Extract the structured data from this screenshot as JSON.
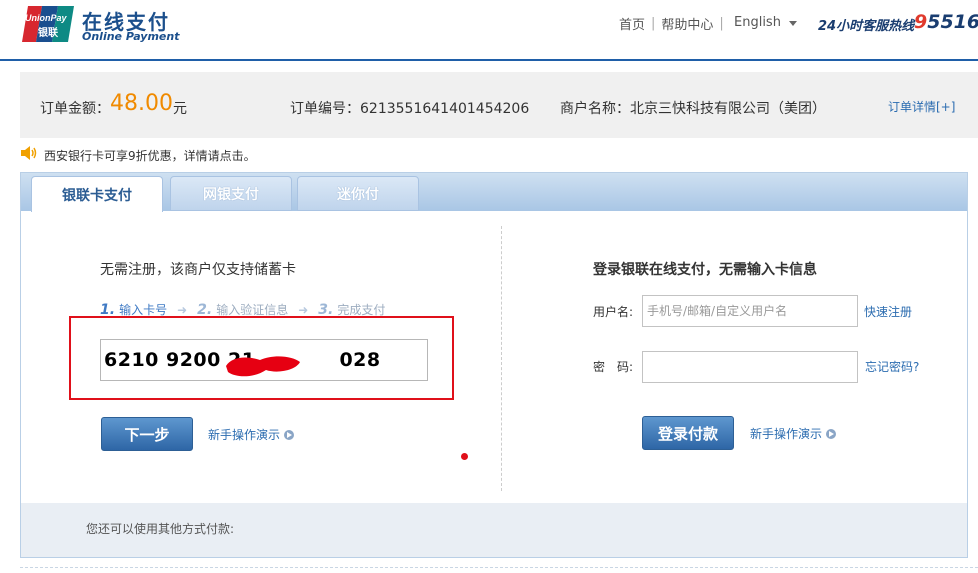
{
  "header": {
    "logo_brand": "在线支付",
    "logo_sub": "Online Payment",
    "logo_text_top": "UnionPay",
    "logo_text_bottom": "银联",
    "nav": [
      {
        "label": "首页"
      },
      {
        "label": "帮助中心"
      }
    ],
    "language": "English",
    "hotline_label": "24小时客服热线",
    "hotline_number_a": "9",
    "hotline_number_b": "5516"
  },
  "order": {
    "amount_label": "订单金额：",
    "amount": "48.00",
    "currency": "元",
    "number_label": "订单编号：",
    "number": "6213551641401454206",
    "merchant_label": "商户名称：",
    "merchant": "北京三快科技有限公司（美团）",
    "details_link": "订单详情[+]"
  },
  "notice": "西安银行卡可享9折优惠，详情请点击。",
  "tabs": [
    {
      "label": "银联卡支付",
      "active": true
    },
    {
      "label": "网银支付",
      "active": false
    },
    {
      "label": "迷你付",
      "active": false
    }
  ],
  "card_pay": {
    "title": "无需注册，该商户仅支持储蓄卡",
    "steps": [
      {
        "num": "1.",
        "label": "输入卡号",
        "active": true
      },
      {
        "num": "2.",
        "label": "输入验证信息",
        "active": false
      },
      {
        "num": "3.",
        "label": "完成支付",
        "active": false
      }
    ],
    "card_number_start": "6210 9200 21",
    "card_number_end": "028",
    "next_button": "下一步",
    "demo_link": "新手操作演示"
  },
  "login": {
    "title": "登录银联在线支付，无需输入卡信息",
    "username_label": "用户名:",
    "username_placeholder": "手机号/邮箱/自定义用户名",
    "register_link": "快速注册",
    "password_label": "密　码:",
    "forgot_link": "忘记密码?",
    "login_button": "登录付款",
    "demo_link": "新手操作演示"
  },
  "other_methods": "您还可以使用其他方式付款:",
  "colors": {
    "brand_blue": "#1f5ea8",
    "amount_orange": "#f08a00",
    "highlight_red": "#e0101a"
  }
}
